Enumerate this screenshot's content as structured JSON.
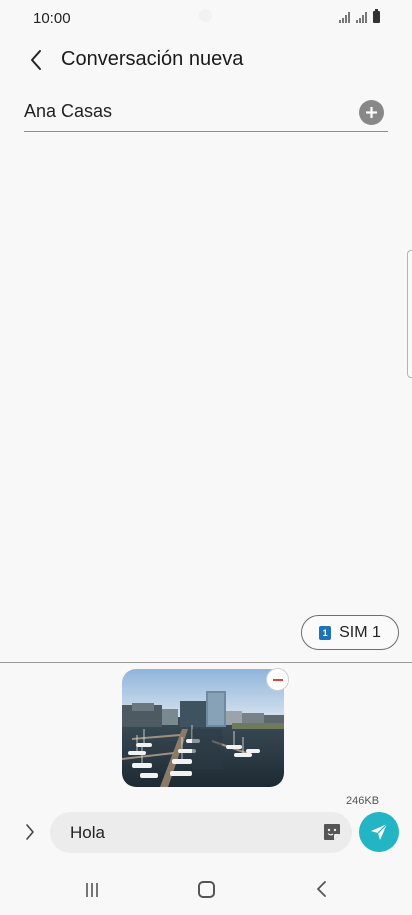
{
  "status_bar": {
    "time": "10:00",
    "icons": [
      "signal-icon",
      "signal-icon",
      "battery-icon"
    ]
  },
  "app_bar": {
    "title": "Conversación nueva",
    "back_icon": "chevron-left-icon"
  },
  "recipient": {
    "name": "Ana Casas",
    "add_icon": "plus-circle-icon"
  },
  "sim": {
    "badge": "1",
    "label": "SIM 1"
  },
  "attachment": {
    "type": "image",
    "description_icon": "harbor-photo",
    "remove_icon": "minus-circle-icon",
    "size": "246KB"
  },
  "composer": {
    "expand_icon": "chevron-right-icon",
    "text": "Hola",
    "sticker_icon": "sticker-icon",
    "send_icon": "send-icon"
  },
  "nav": {
    "recents_icon": "recents-icon",
    "home_icon": "home-icon",
    "back_icon": "back-icon"
  },
  "colors": {
    "accent": "#23b5c3",
    "sim_badge": "#1f72b8",
    "remove": "#e0453c"
  }
}
